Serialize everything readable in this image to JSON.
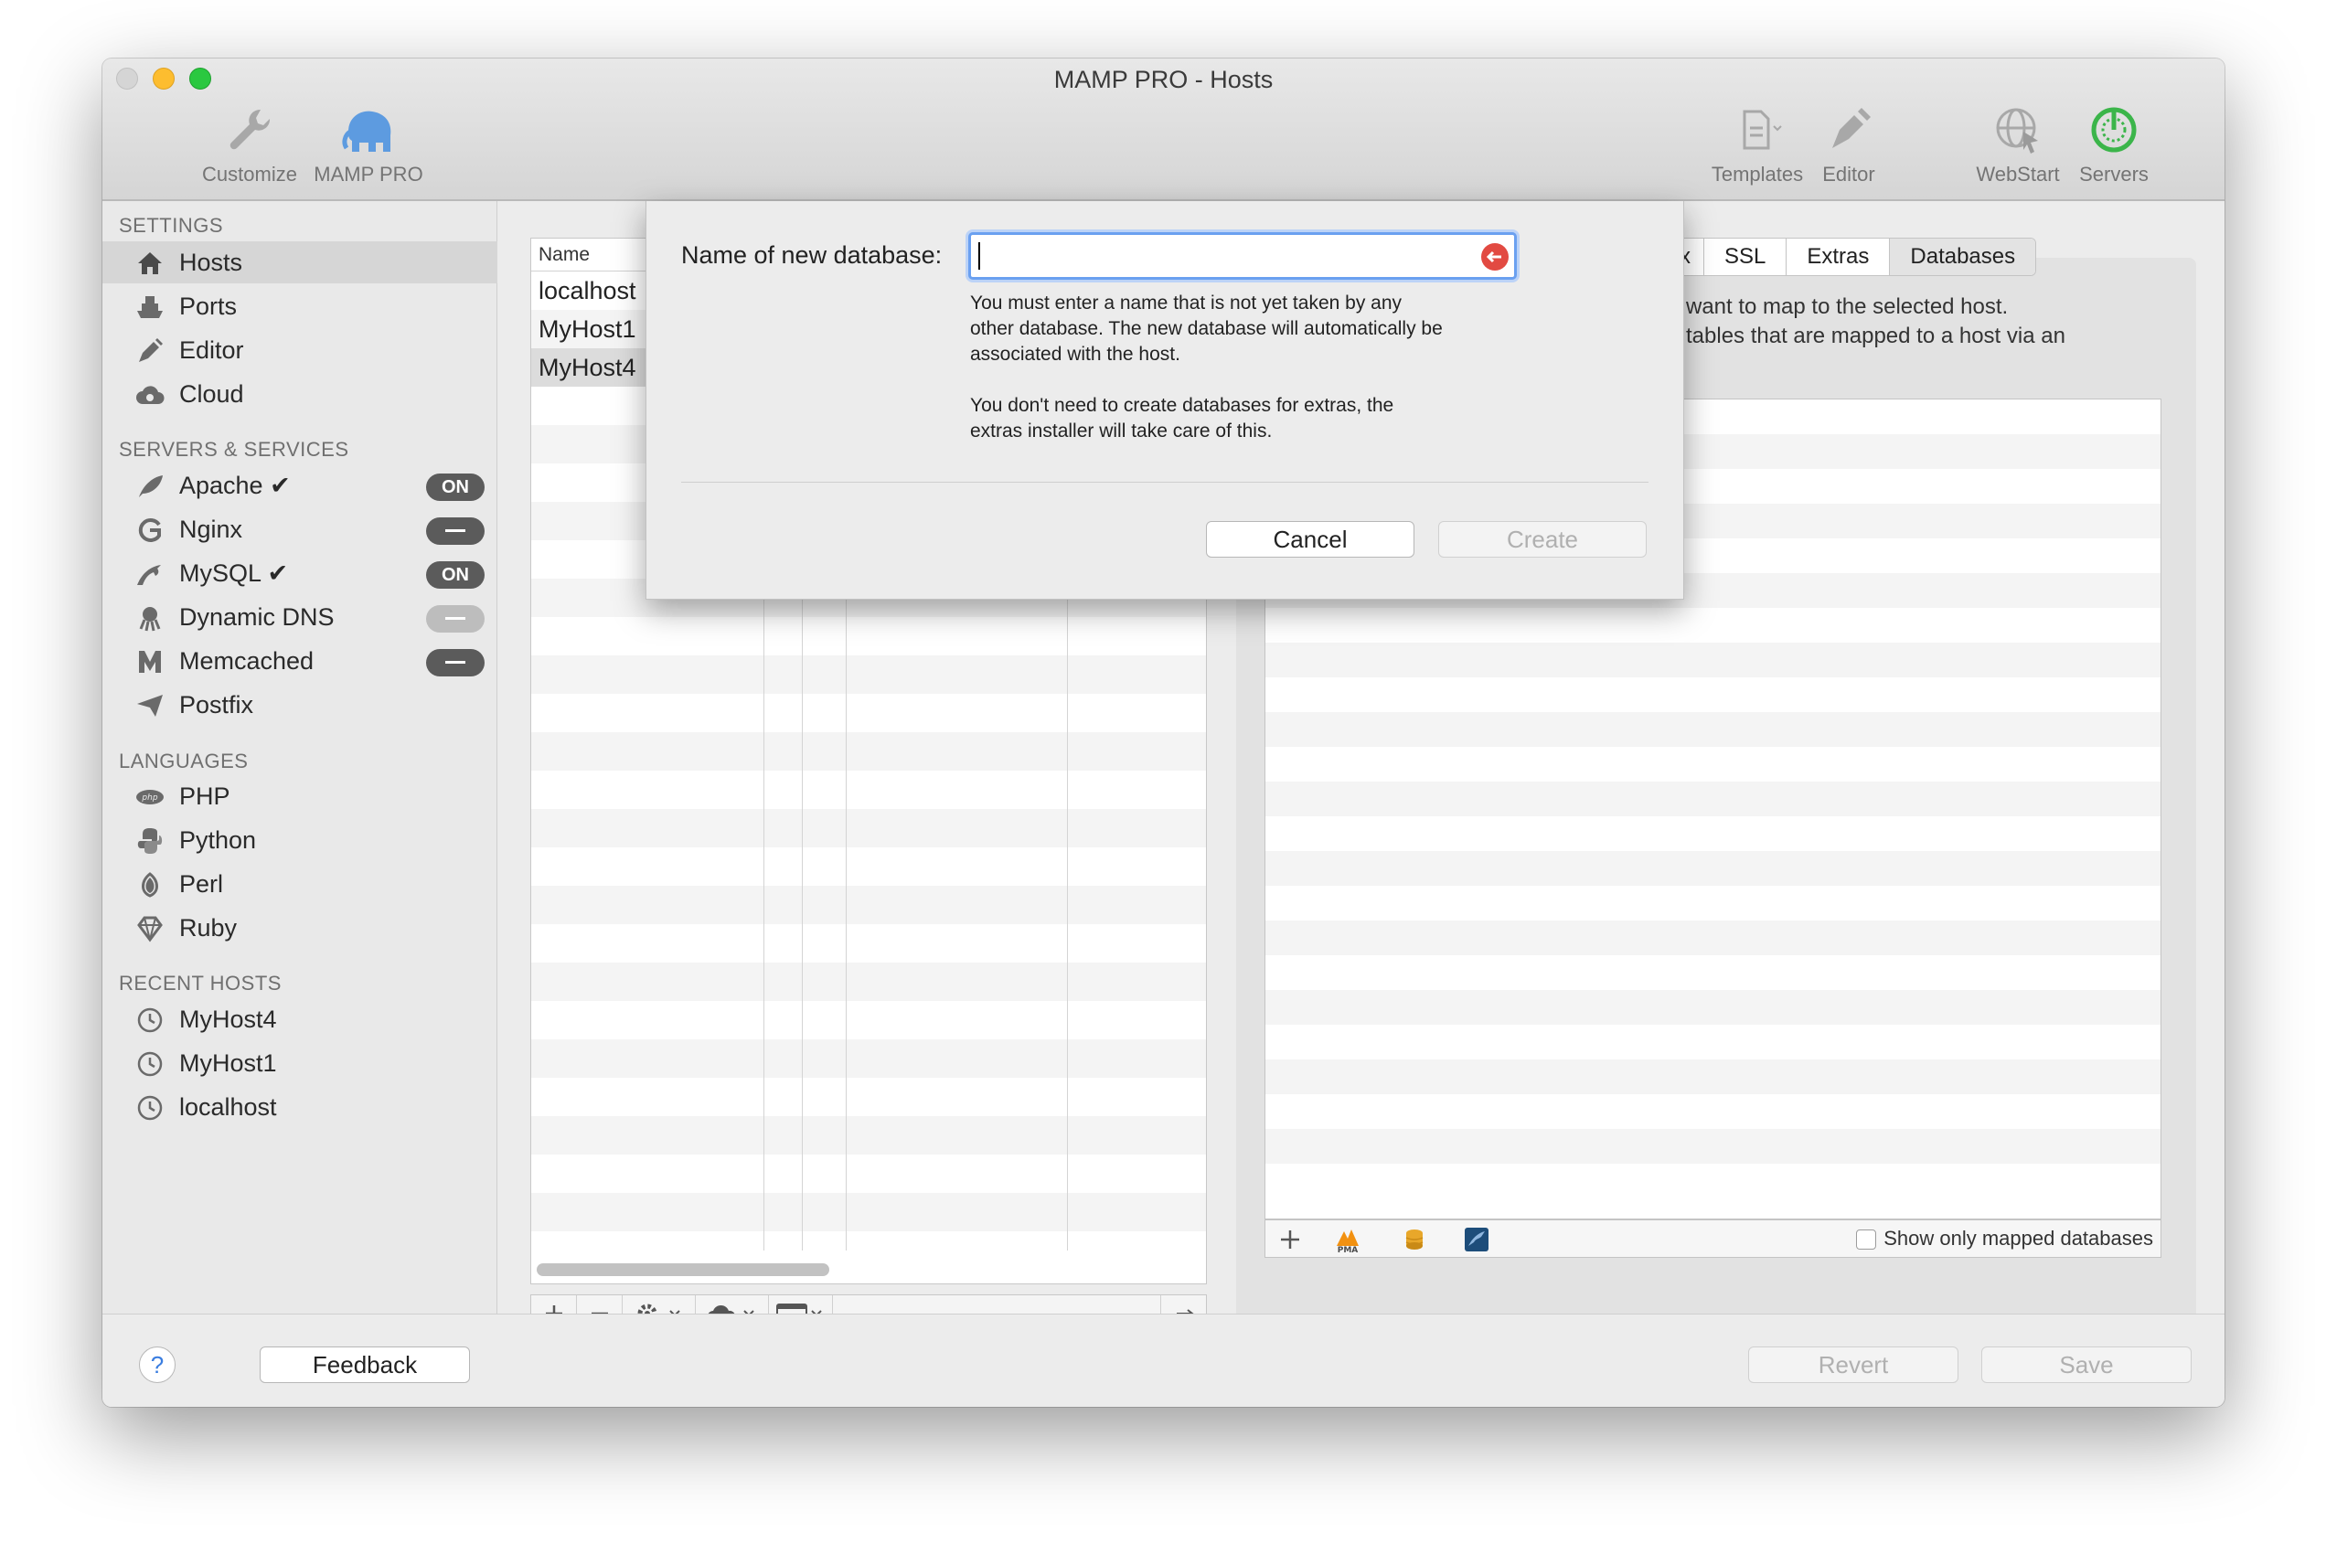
{
  "window": {
    "title": "MAMP PRO - Hosts"
  },
  "toolbar": {
    "customize": "Customize",
    "mamp_pro": "MAMP PRO",
    "templates": "Templates",
    "editor": "Editor",
    "webstart": "WebStart",
    "servers": "Servers"
  },
  "sidebar": {
    "settings_header": "SETTINGS",
    "settings": [
      {
        "label": "Hosts",
        "icon": "home-icon"
      },
      {
        "label": "Ports",
        "icon": "ship-icon"
      },
      {
        "label": "Editor",
        "icon": "pen-icon"
      },
      {
        "label": "Cloud",
        "icon": "cloud-icon"
      }
    ],
    "servers_header": "SERVERS & SERVICES",
    "servers": [
      {
        "label": "Apache ✔",
        "status": "ON"
      },
      {
        "label": "Nginx",
        "status": "—"
      },
      {
        "label": "MySQL ✔",
        "status": "ON"
      },
      {
        "label": "Dynamic DNS",
        "status": "—"
      },
      {
        "label": "Memcached",
        "status": "—"
      },
      {
        "label": "Postfix",
        "status": ""
      }
    ],
    "languages_header": "LANGUAGES",
    "languages": [
      {
        "label": "PHP"
      },
      {
        "label": "Python"
      },
      {
        "label": "Perl"
      },
      {
        "label": "Ruby"
      }
    ],
    "recent_header": "RECENT HOSTS",
    "recent": [
      {
        "label": "MyHost4"
      },
      {
        "label": "MyHost1"
      },
      {
        "label": "localhost"
      }
    ]
  },
  "hosts_table": {
    "column_name": "Name",
    "rows": [
      "localhost",
      "MyHost1",
      "MyHost4"
    ],
    "selected_index": 2
  },
  "tabs": [
    {
      "label": "x"
    },
    {
      "label": "SSL"
    },
    {
      "label": "Extras"
    },
    {
      "label": "Databases"
    }
  ],
  "databases_panel": {
    "desc_line1": "want to map to the selected host.",
    "desc_line2": "tables that are mapped to a host via an",
    "show_mapped_label": "Show only mapped databases",
    "pma_label": "PMA"
  },
  "dialog": {
    "label": "Name of new database:",
    "input_value": "",
    "hint1_line1": "You must enter a name that is not yet taken by any",
    "hint1_line2": "other database. The new database will automatically be",
    "hint1_line3": "associated with the host.",
    "hint2_line1": "You don't need to create databases for extras, the",
    "hint2_line2": "extras installer will take care of this.",
    "cancel": "Cancel",
    "create": "Create"
  },
  "footer": {
    "help": "?",
    "feedback": "Feedback",
    "revert": "Revert",
    "save": "Save"
  },
  "colors": {
    "accent_blue": "#6aa0f0",
    "servers_green": "#3bb54a",
    "clear_red": "#e24a42",
    "pill_dark": "#5b5b5b"
  }
}
